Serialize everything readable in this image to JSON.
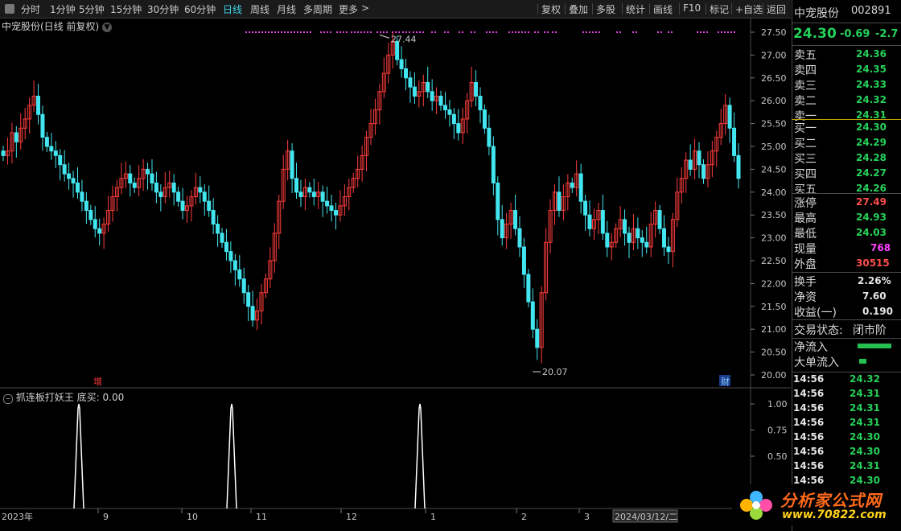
{
  "toolbar": {
    "periods": [
      "分时",
      "1分钟",
      "5分钟",
      "15分钟",
      "30分钟",
      "60分钟",
      "日线",
      "周线",
      "月线",
      "多周期",
      "更多"
    ],
    "active_period": "日线",
    "more_arrow": ">",
    "buttons": [
      "复权",
      "叠加",
      "多股",
      "统计",
      "画线",
      "F10",
      "标记",
      "+自选",
      "返回"
    ]
  },
  "main": {
    "title": "中宠股份(日线 前复权)",
    "high_label": "27.44",
    "low_label": "20.07",
    "marker_zeng": "增",
    "marker_cai": "财",
    "y_ticks": [
      "27.50",
      "27.00",
      "26.50",
      "26.00",
      "25.50",
      "25.00",
      "24.50",
      "24.00",
      "23.50",
      "23.00",
      "22.50",
      "22.00",
      "21.50",
      "21.00",
      "20.50",
      "20.00"
    ]
  },
  "indicator": {
    "title": "抓连板打妖王 底买: 0.00",
    "y_ticks": [
      "1.00",
      "0.75",
      "0.50"
    ]
  },
  "x_axis": {
    "labels": [
      "2023年",
      "9",
      "10",
      "11",
      "12",
      "1",
      "2",
      "3",
      "2024/03/12/二"
    ]
  },
  "side": {
    "stock_name": "中宠股份",
    "stock_code": "002891",
    "price": "24.30",
    "change": "-0.69",
    "change_pct": "-2.7",
    "asks": [
      {
        "label": "卖五",
        "price": "24.36"
      },
      {
        "label": "卖四",
        "price": "24.35"
      },
      {
        "label": "卖三",
        "price": "24.33"
      },
      {
        "label": "卖二",
        "price": "24.32"
      },
      {
        "label": "卖一",
        "price": "24.31"
      }
    ],
    "bids": [
      {
        "label": "买一",
        "price": "24.30"
      },
      {
        "label": "买二",
        "price": "24.29"
      },
      {
        "label": "买三",
        "price": "24.28"
      },
      {
        "label": "买四",
        "price": "24.27"
      },
      {
        "label": "买五",
        "price": "24.26"
      }
    ],
    "stats": [
      {
        "label": "涨停",
        "value": "27.49",
        "color": "red"
      },
      {
        "label": "最高",
        "value": "24.93",
        "color": "green"
      },
      {
        "label": "最低",
        "value": "24.03",
        "color": "green"
      },
      {
        "label": "现量",
        "value": "768",
        "color": "mag"
      },
      {
        "label": "外盘",
        "value": "30515",
        "color": "red"
      }
    ],
    "stats2": [
      {
        "label": "换手",
        "value": "2.26%"
      },
      {
        "label": "净资",
        "value": "7.60"
      },
      {
        "label": "收益(一)",
        "value": "0.190"
      }
    ],
    "trade_status_label": "交易状态:",
    "trade_status_value": "闭市阶",
    "net_inflow_label": "净流入",
    "big_inflow_label": "大单流入",
    "ticks": [
      {
        "time": "14:56",
        "price": "24.32"
      },
      {
        "time": "14:56",
        "price": "24.31"
      },
      {
        "time": "14:56",
        "price": "24.31"
      },
      {
        "time": "14:56",
        "price": "24.31"
      },
      {
        "time": "14:56",
        "price": "24.30"
      },
      {
        "time": "14:56",
        "price": "24.30"
      },
      {
        "time": "14:56",
        "price": "24.31"
      },
      {
        "time": "14:56",
        "price": "24.30"
      }
    ]
  },
  "watermark": {
    "text": "分析家公式网",
    "url": "www.70822.com"
  },
  "colors": {
    "up": "#ff3c3c",
    "down": "#42e6f0",
    "bg": "#000000",
    "grid": "#3a3a3a",
    "accent": "#3fd2e8"
  },
  "chart_data": {
    "type": "candlestick",
    "ylim": [
      20.0,
      27.5
    ],
    "high": 27.44,
    "low": 20.07,
    "closes": [
      24.8,
      24.9,
      25.3,
      25.1,
      25.4,
      25.6,
      25.9,
      26.1,
      25.7,
      25.2,
      25.0,
      24.9,
      24.8,
      24.6,
      24.4,
      24.3,
      24.2,
      24.0,
      23.8,
      23.6,
      23.4,
      23.2,
      23.1,
      23.3,
      23.6,
      23.9,
      24.1,
      24.3,
      24.4,
      24.2,
      24.1,
      24.3,
      24.5,
      24.4,
      24.2,
      24.0,
      23.9,
      24.1,
      24.2,
      24.0,
      23.8,
      23.6,
      23.7,
      23.9,
      24.1,
      24.0,
      23.8,
      23.6,
      23.3,
      23.1,
      22.9,
      22.7,
      22.5,
      22.3,
      22.1,
      21.8,
      21.5,
      21.2,
      21.4,
      21.8,
      22.1,
      22.5,
      23.1,
      23.8,
      24.5,
      24.9,
      24.3,
      24.0,
      23.9,
      24.1,
      24.0,
      23.9,
      24.0,
      23.8,
      23.7,
      23.6,
      23.5,
      23.7,
      23.9,
      24.1,
      24.3,
      24.5,
      24.8,
      25.2,
      25.5,
      25.8,
      26.2,
      26.6,
      27.0,
      27.3,
      26.9,
      26.7,
      26.5,
      26.3,
      26.1,
      26.2,
      26.4,
      26.2,
      26.0,
      26.1,
      25.9,
      25.8,
      25.7,
      25.5,
      25.3,
      25.6,
      26.0,
      26.4,
      26.1,
      25.8,
      25.4,
      25.0,
      24.2,
      23.4,
      23.0,
      23.3,
      23.6,
      23.2,
      22.8,
      22.2,
      21.6,
      21.0,
      20.6,
      21.8,
      22.9,
      23.6,
      24.0,
      23.6,
      23.9,
      24.2,
      24.1,
      24.4,
      23.8,
      23.5,
      23.2,
      23.4,
      23.6,
      23.1,
      22.8,
      22.9,
      23.2,
      23.4,
      23.1,
      22.9,
      23.2,
      23.0,
      22.9,
      22.8,
      23.3,
      23.6,
      23.2,
      22.8,
      22.7,
      23.4,
      24.0,
      24.3,
      24.7,
      24.5,
      24.9,
      24.6,
      24.3,
      24.6,
      24.9,
      25.2,
      25.5,
      25.9,
      25.4,
      24.8,
      24.3
    ]
  }
}
